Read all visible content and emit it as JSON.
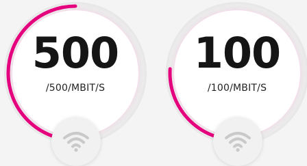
{
  "gauges": [
    {
      "value": "500",
      "unit": "/500/MBIT/S",
      "progress": 0.5
    },
    {
      "value": "100",
      "unit": "/100/MBIT/S",
      "progress": 0.26
    }
  ],
  "colors": {
    "accent": "#e5007d",
    "track": "#ececec",
    "face": "#ffffff",
    "wifi_icon": "#c9c9c9"
  },
  "icons": [
    "wifi-icon"
  ]
}
